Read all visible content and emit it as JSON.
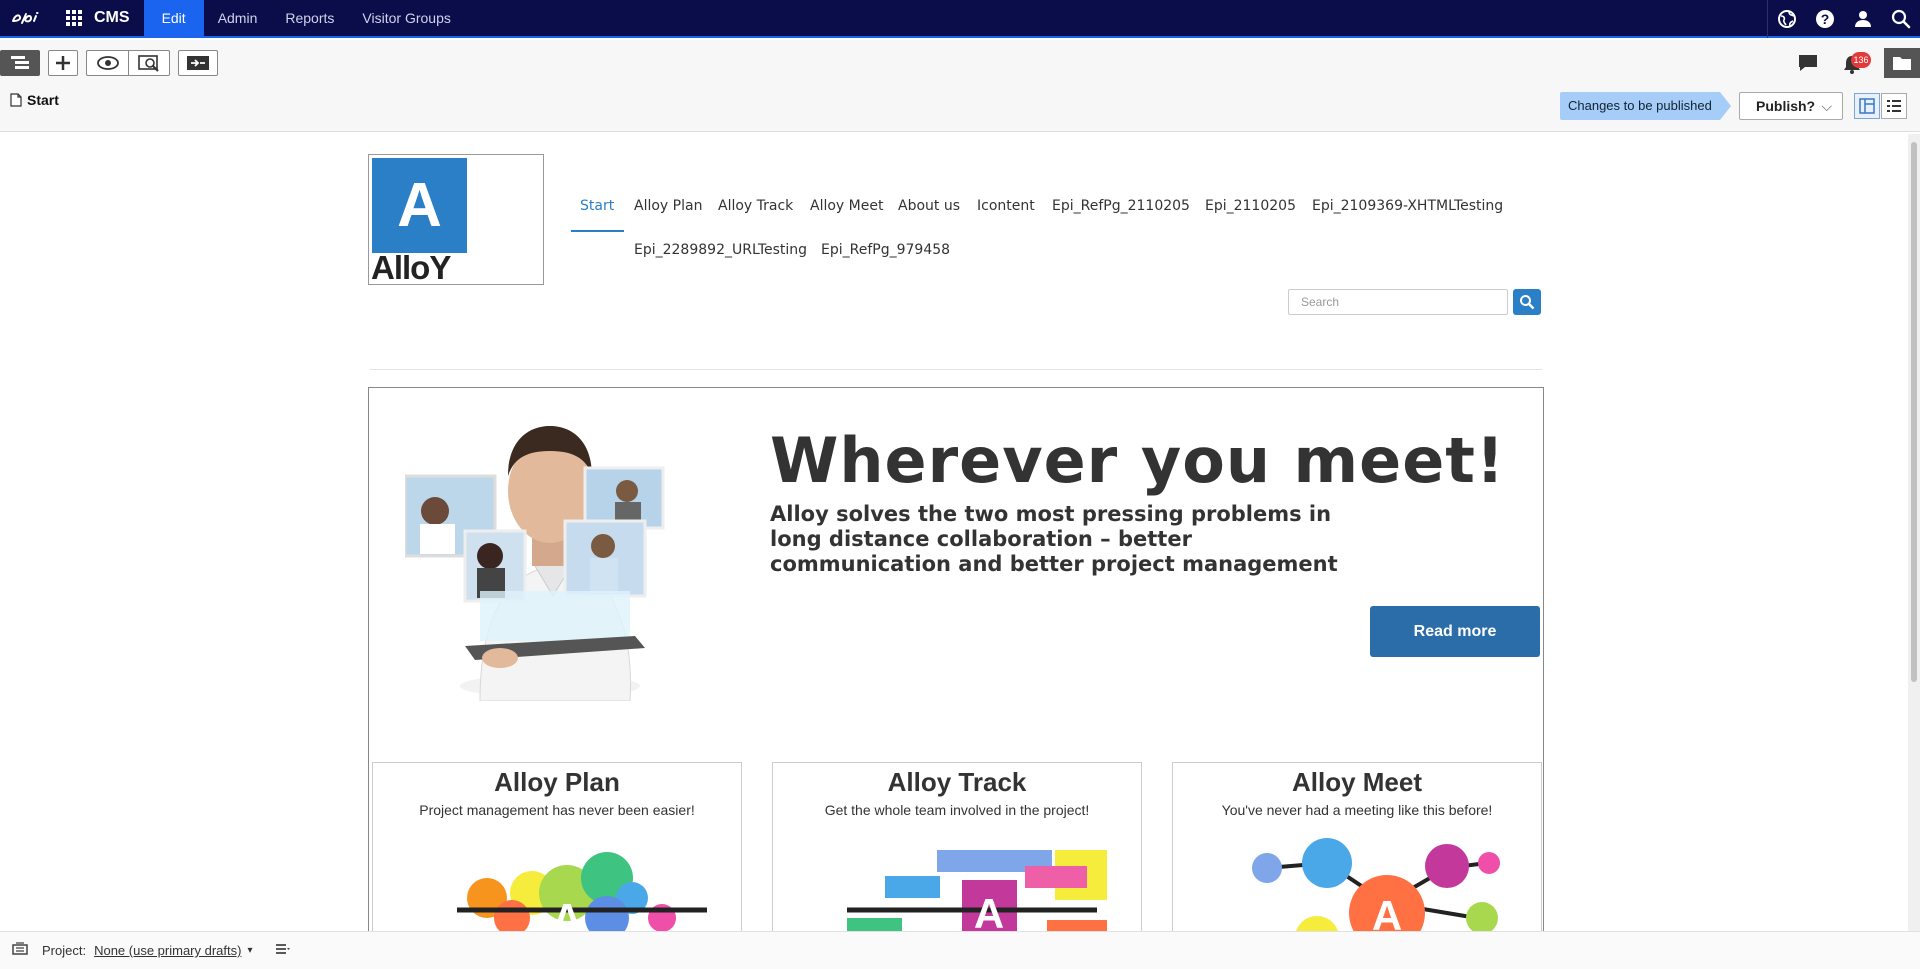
{
  "topbar": {
    "brand": "epi",
    "cms": "CMS",
    "nav": [
      "Edit",
      "Admin",
      "Reports",
      "Visitor Groups"
    ]
  },
  "toolbar": {
    "breadcrumb": "Start",
    "status": "Changes to be published",
    "publish": "Publish?",
    "notifications": "136"
  },
  "site": {
    "logo_letter": "A",
    "logo_word": "AlloY",
    "menu": [
      "Start",
      "Alloy Plan",
      "Alloy Track",
      "Alloy Meet",
      "About us",
      "Icontent",
      "Epi_RefPg_2110205",
      "Epi_2110205",
      "Epi_2109369-XHTMLTesting",
      "Epi_2289892_URLTesting",
      "Epi_RefPg_979458"
    ],
    "search_placeholder": "Search",
    "hero": {
      "title": "Wherever you meet!",
      "text": "Alloy solves the two most pressing problems in long distance collaboration – better communication and better project management",
      "button": "Read more"
    },
    "cards": [
      {
        "title": "Alloy Plan",
        "text": "Project management has never been easier!"
      },
      {
        "title": "Alloy Track",
        "text": "Get the whole team involved in the project!"
      },
      {
        "title": "Alloy Meet",
        "text": "You've never had a meeting like this before!"
      }
    ]
  },
  "statusbar": {
    "label": "Project:",
    "value": "None (use primary drafts)"
  }
}
